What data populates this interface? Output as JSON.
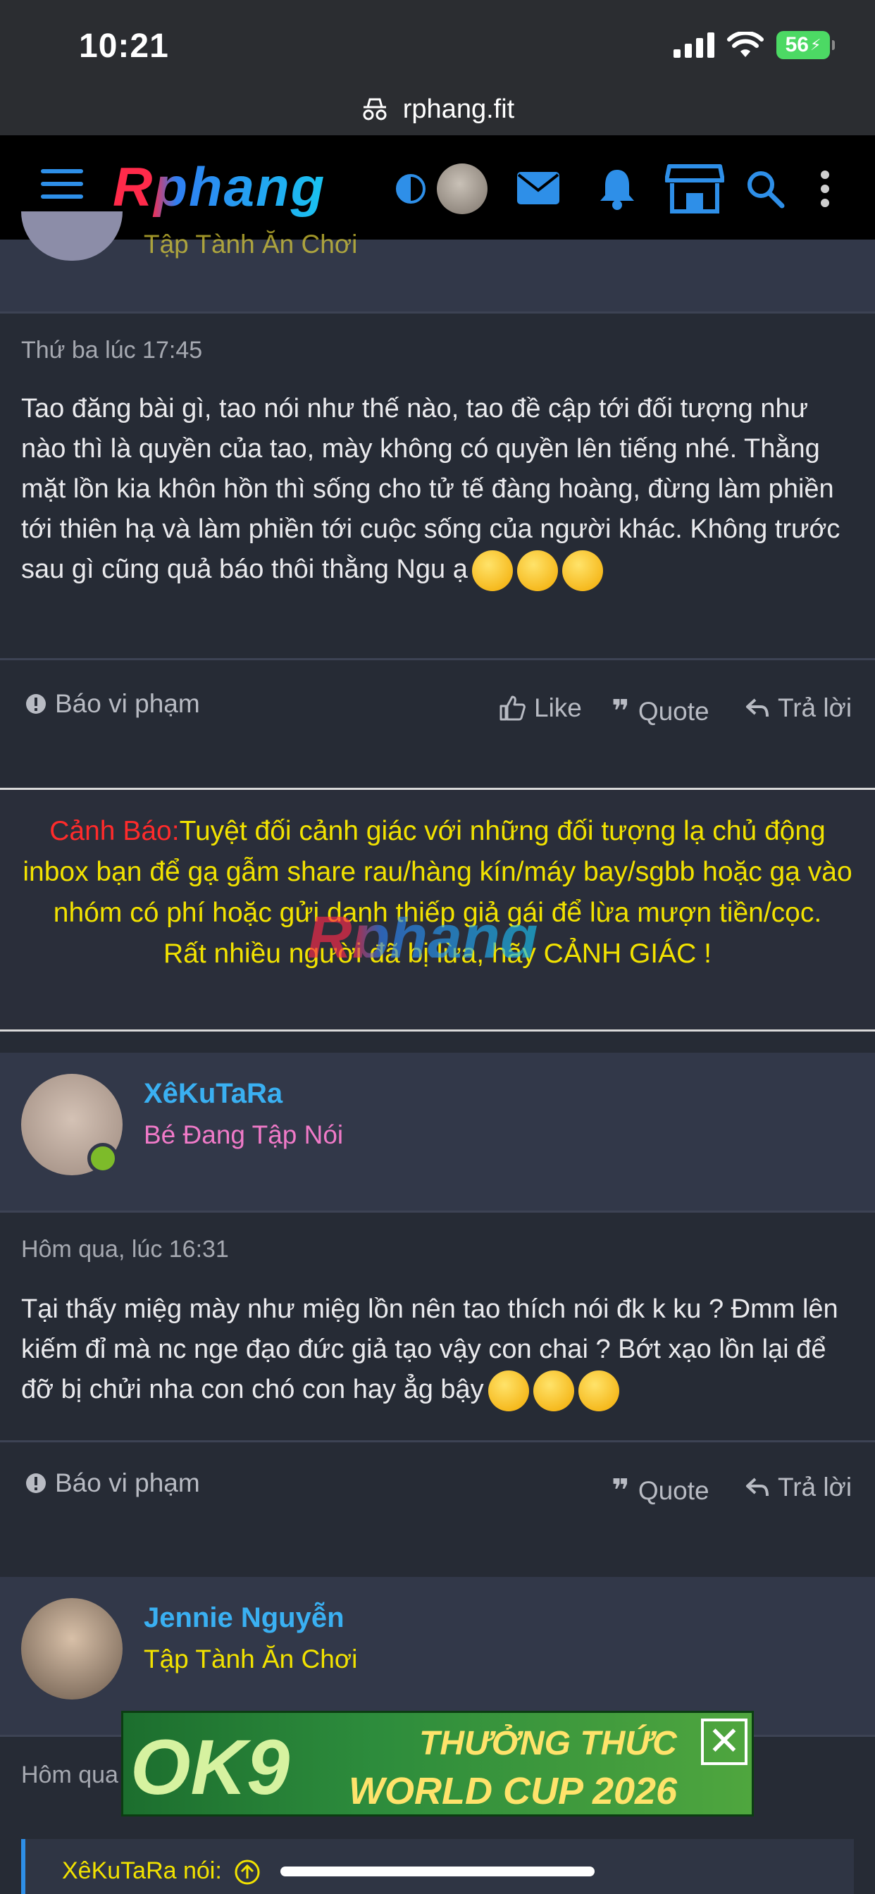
{
  "status_bar": {
    "time": "10:21",
    "battery": "56"
  },
  "browser": {
    "url": "rphang.fit"
  },
  "site": {
    "logo": "Rphang"
  },
  "post1": {
    "user_title_partial": "Tập Tành Ăn Chơi",
    "timestamp": "Thứ ba lúc 17:45",
    "body": "Tao đăng bài gì, tao nói như thế nào, tao đề cập tới đối tượng như nào thì là quyền của tao, mày không có quyền lên tiếng nhé. Thằng mặt lồn kia khôn hồn thì sống cho tử tế đàng hoàng, đừng làm phiền tới thiên hạ và làm phiền tới cuộc sống của người khác. Không trước sau gì cũng quả báo thôi thằng Ngu ạ",
    "report_label": "Báo vi phạm",
    "like_label": "Like",
    "quote_label": "Quote",
    "reply_label": "Trả lời"
  },
  "warning": {
    "label": "Cảnh Báo:",
    "text": "Tuyệt đối cảnh giác với những đối tượng lạ chủ động inbox bạn để gạ gẫm share rau/hàng kín/máy bay/sgbb hoặc gạ vào nhóm có phí hoặc gửi danh thiếp giả gái để lừa mượn tiền/cọc.",
    "line2": "Rất nhiều người đã bị lừa, hãy CẢNH GIÁC !",
    "watermark": "Rphang"
  },
  "post2": {
    "username": "XêKuTaRa",
    "user_title": "Bé Đang Tập Nói",
    "timestamp": "Hôm qua, lúc 16:31",
    "body": "Tại thấy miệg mày như miệg lồn nên tao thích nói đk k ku ? Đmm lên kiếm đỉ mà nc nge đạo đức giả tạo vậy con chai ? Bớt xạo lồn lại để đỡ bị chửi nha con chó con hay ẳg bậy",
    "report_label": "Báo vi phạm",
    "quote_label": "Quote",
    "reply_label": "Trả lời"
  },
  "post3": {
    "username": "Jennie Nguyễn",
    "user_title": "Tập Tành Ăn Chơi",
    "timestamp_partial": "Hôm qua",
    "quote_author": "XêKuTaRa nói:"
  },
  "ad": {
    "logo": "OK9",
    "line1": "THƯỞNG THỨC",
    "line2": "WORLD CUP 2026",
    "close": "✕"
  },
  "colors": {
    "accent": "#2e8fe8",
    "username": "#3ab0f2",
    "warning_yellow": "#f2e200",
    "warning_red": "#ff2b2b",
    "title_pink": "#f07ac8"
  }
}
